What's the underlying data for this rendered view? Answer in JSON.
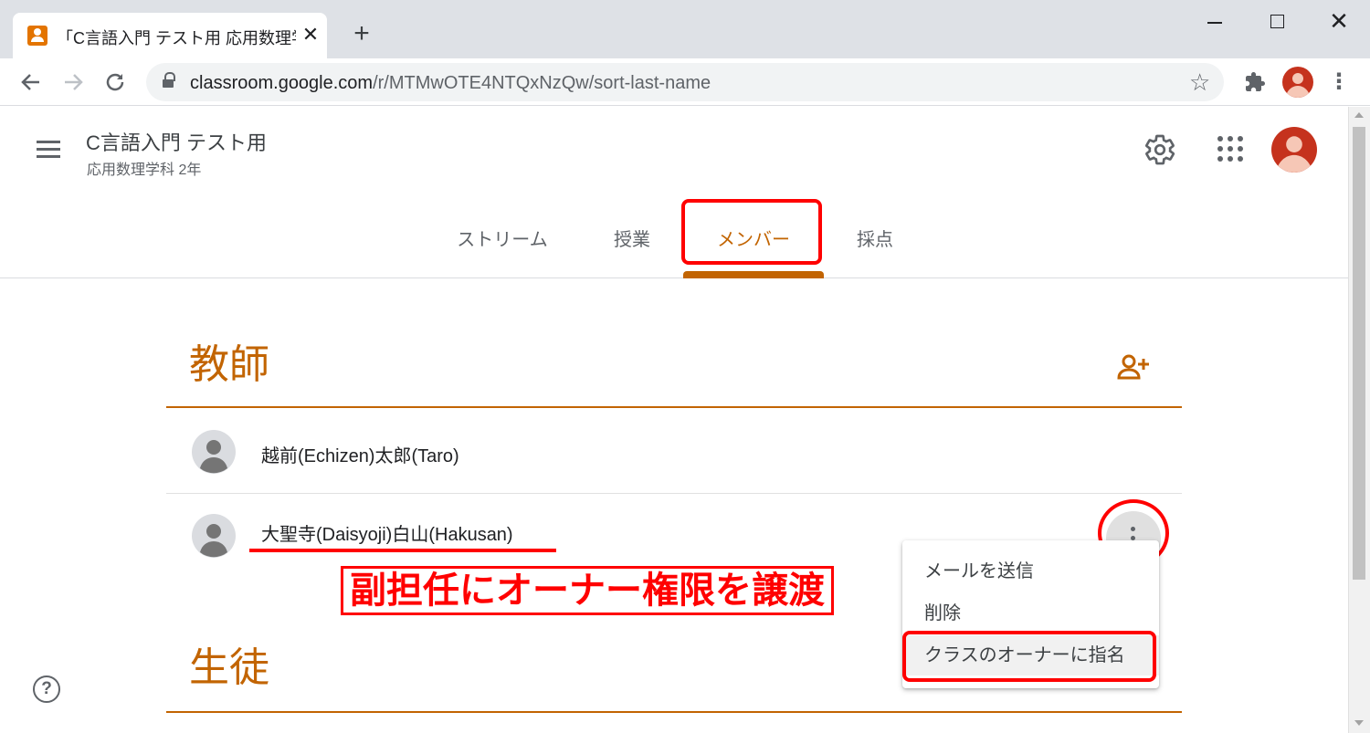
{
  "browser": {
    "tab_title": "「C言語入門 テスト用 応用数理学科",
    "tab_close": "✕",
    "new_tab": "+",
    "url_host": "classroom.google.com",
    "url_path": "/r/MTMwOTE4NTQxNzQw/sort-last-name",
    "icons": [
      "back-icon",
      "forward-icon",
      "reload-icon",
      "lock-icon",
      "star-icon",
      "extensions-icon",
      "profile-icon",
      "menu-icon"
    ]
  },
  "header": {
    "title": "C言語入門 テスト用",
    "subtitle": "応用数理学科 2年"
  },
  "tabs": [
    {
      "label": "ストリーム"
    },
    {
      "label": "授業"
    },
    {
      "label": "メンバー"
    },
    {
      "label": "採点"
    }
  ],
  "teachers": {
    "title": "教師",
    "members": [
      {
        "name": "越前(Echizen)太郎(Taro)"
      },
      {
        "name": "大聖寺(Daisyoji)白山(Hakusan)"
      }
    ]
  },
  "students": {
    "title": "生徒"
  },
  "context_menu": {
    "items": [
      {
        "label": "メールを送信"
      },
      {
        "label": "削除"
      },
      {
        "label": "クラスのオーナーに指名"
      }
    ]
  },
  "annotation": {
    "callout": "副担任にオーナー権限を譲渡"
  },
  "help": {
    "label": "?"
  },
  "colors": {
    "accent": "#c26401",
    "annotation": "#ff0000",
    "chrome": "#dee1e6",
    "avatar_red": "#c5321d"
  }
}
